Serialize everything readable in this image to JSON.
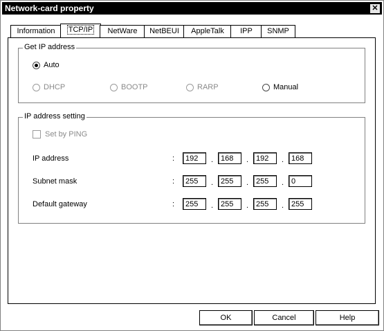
{
  "window": {
    "title": "Network-card property",
    "close_label": "✕"
  },
  "tabs": [
    {
      "label": "Information"
    },
    {
      "label": "TCP/IP"
    },
    {
      "label": "NetWare"
    },
    {
      "label": "NetBEUI"
    },
    {
      "label": "AppleTalk"
    },
    {
      "label": "IPP"
    },
    {
      "label": "SNMP"
    }
  ],
  "active_tab": "TCP/IP",
  "get_ip": {
    "title": "Get IP address",
    "auto": "Auto",
    "dhcp": "DHCP",
    "bootp": "BOOTP",
    "rarp": "RARP",
    "manual": "Manual",
    "selected": "Auto"
  },
  "ip_setting": {
    "title": "IP address setting",
    "set_by_ping": "Set by PING",
    "colon": ":",
    "dot": ".",
    "rows": [
      {
        "label": "IP address",
        "octets": [
          "192",
          "168",
          "192",
          "168"
        ]
      },
      {
        "label": "Subnet mask",
        "octets": [
          "255",
          "255",
          "255",
          "0"
        ]
      },
      {
        "label": "Default gateway",
        "octets": [
          "255",
          "255",
          "255",
          "255"
        ]
      }
    ]
  },
  "buttons": {
    "ok": "OK",
    "cancel": "Cancel",
    "help": "Help"
  }
}
